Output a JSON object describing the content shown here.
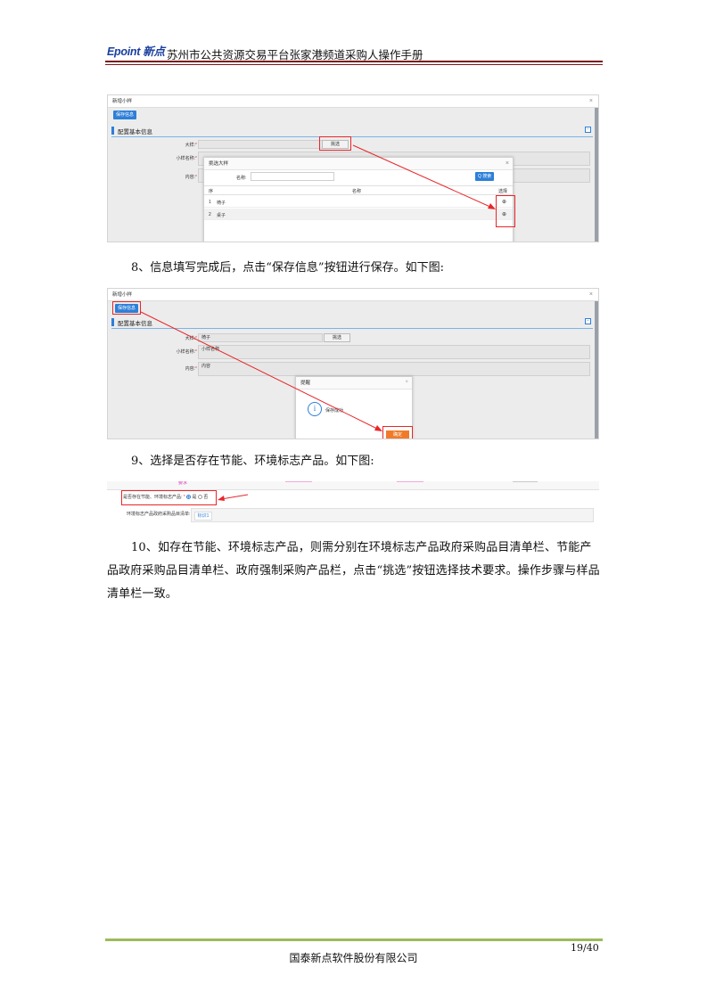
{
  "header": {
    "logo_text": "Epoint 新点",
    "title": "苏州市公共资源交易平台张家港频道采购人操作手册"
  },
  "shot1": {
    "window_title": "新增小样",
    "save_button": "保存信息",
    "section_title": "配置基本信息",
    "field_dayang": "大样:",
    "field_xiaoyang": "小样名称:",
    "field_neirong": "内容:",
    "select_button": "挑选",
    "dialog": {
      "title": "挑选大样",
      "search_label": "名称:",
      "search_button": "Q 搜索",
      "col_index": "序",
      "col_name": "名称",
      "col_select": "选择",
      "rows": [
        {
          "index": "1",
          "name": "椅子"
        },
        {
          "index": "2",
          "name": "桌子"
        }
      ]
    }
  },
  "step8": "8、信息填写完成后，点击“保存信息”按钮进行保存。如下图:",
  "shot2": {
    "window_title": "新增小样",
    "save_button": "保存信息",
    "section_title": "配置基本信息",
    "field_dayang": "大样:",
    "field_xiaoyang": "小样名称:",
    "field_neirong": "内容:",
    "value_dayang": "椅子",
    "value_xiaoyang": "小样名称",
    "value_neirong": "内容",
    "select_button": "挑选",
    "dialog": {
      "title": "提醒",
      "message": "保存成功",
      "ok_button": "确定"
    }
  },
  "step9": "9、选择是否存在节能、环境标志产品。如下图:",
  "shot3": {
    "top_link": "要求",
    "question": "是否存在节能、环境标志产品:",
    "opt_yes": "是",
    "opt_no": "否",
    "list_label": "环境标志产品政府采购品目清单:",
    "tab_label": "标识1"
  },
  "step10": "10、如存在节能、环境标志产品，则需分别在环境标志产品政府采购品目清单栏、节能产品政府采购品目清单栏、政府强制采购产品栏，点击“挑选”按钮选择技术要求。操作步骤与样品清单栏一致。",
  "footer": {
    "page_number": "19/40",
    "company": "国泰新点软件股份有限公司"
  },
  "colors": {
    "accent": "#2d7fd8",
    "highlight_red": "#e8262a",
    "header_rule": "#7a1a1a",
    "footer_rule": "#9bbb59",
    "confirm_orange": "#f07a2a"
  }
}
